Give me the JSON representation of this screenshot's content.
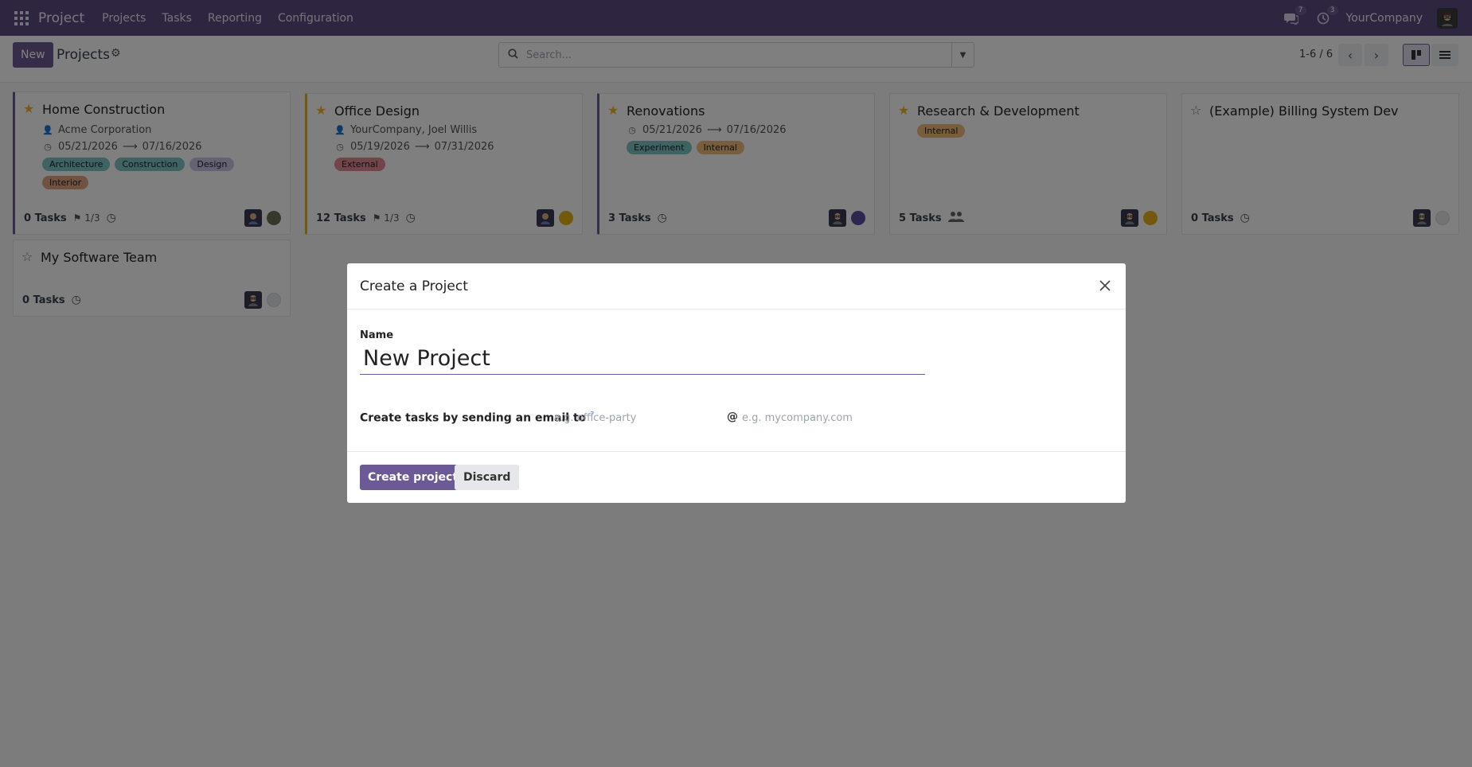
{
  "navbar": {
    "app_name": "Project",
    "menu": [
      "Projects",
      "Tasks",
      "Reporting",
      "Configuration"
    ],
    "messages_count": "7",
    "activities_count": "3",
    "company": "YourCompany"
  },
  "control": {
    "new_label": "New",
    "title": "Projects",
    "search_placeholder": "Search...",
    "pager": "1-6 / 6"
  },
  "projects": [
    {
      "name": "Home Construction",
      "favorite": true,
      "customer": "Acme Corporation",
      "date_start": "05/21/2026",
      "date_end": "07/16/2026",
      "tags": [
        "Architecture",
        "Construction",
        "Design",
        "Interior"
      ],
      "tasks": "0 Tasks",
      "milestones": "1/3",
      "status_color": "#6b7058"
    },
    {
      "name": "Office Design",
      "favorite": true,
      "customer": "YourCompany, Joel Willis",
      "date_start": "05/19/2026",
      "date_end": "07/31/2026",
      "tags": [
        "External"
      ],
      "tasks": "12 Tasks",
      "milestones": "1/3",
      "status_color": "#e8b21a"
    },
    {
      "name": "Renovations",
      "favorite": true,
      "date_start": "05/21/2026",
      "date_end": "07/16/2026",
      "tags": [
        "Experiment",
        "Internal"
      ],
      "tasks": "3 Tasks",
      "status_color": "#5a4fa0"
    },
    {
      "name": "Research & Development",
      "favorite": true,
      "tags": [
        "Internal"
      ],
      "tasks": "5 Tasks",
      "status_color": "#e8b21a"
    },
    {
      "name": "(Example) Billing System Dev",
      "favorite": false,
      "tasks": "0 Tasks",
      "status_color": "#e5e7eb"
    },
    {
      "name": "My Software Team",
      "favorite": false,
      "tasks": "0 Tasks",
      "status_color": "#e5e7eb"
    }
  ],
  "tag_colors": {
    "Architecture": "#7fc4c7",
    "Construction": "#7fc4c7",
    "Design": "#c9c7e6",
    "Interior": "#e2a583",
    "External": "#e28a93",
    "Experiment": "#7fc4c7",
    "Internal": "#f0bc7a"
  },
  "dialog": {
    "title": "Create a Project",
    "name_label": "Name",
    "name_value": "New Project",
    "email_label": "Create tasks by sending an email to",
    "help_mark": "?",
    "alias_placeholder": "e.g. office-party",
    "at_sign": "@",
    "domain_placeholder": "e.g. mycompany.com",
    "create_label": "Create project",
    "discard_label": "Discard"
  }
}
